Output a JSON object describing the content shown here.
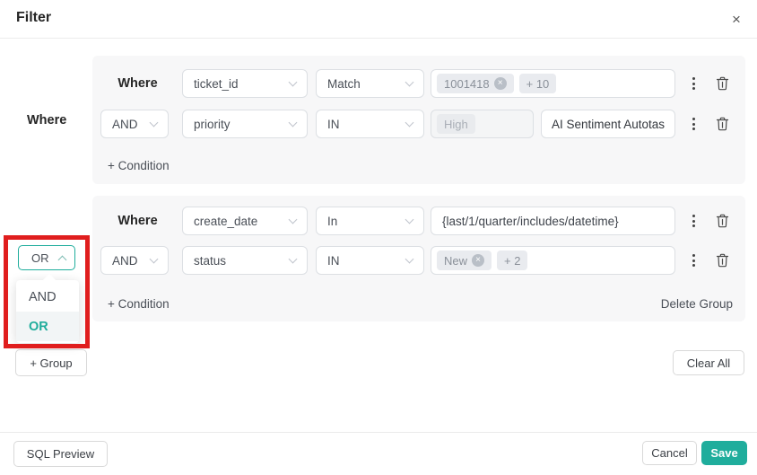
{
  "colors": {
    "accent": "#1fad9c",
    "annotation_red": "#e01e1e"
  },
  "header": {
    "title": "Filter",
    "close_glyph": "×"
  },
  "sidebar": {
    "where_label": "Where"
  },
  "icons": {
    "remove_glyph": "×"
  },
  "conjunction": {
    "selected": "OR",
    "options": [
      "AND",
      "OR"
    ]
  },
  "groups": [
    {
      "rows": [
        {
          "prefix": "Where",
          "field": "ticket_id",
          "operator": "Match",
          "tags": [
            {
              "label": "1001418",
              "removable": true
            },
            {
              "label": "+ 10",
              "removable": false
            }
          ]
        },
        {
          "prefix": "AND",
          "field": "priority",
          "operator": "IN",
          "tags": [
            {
              "label": "High",
              "removable": false
            }
          ],
          "value_disabled": true,
          "action_button": "AI Sentiment Autotas"
        }
      ],
      "add_condition_label": "+ Condition"
    },
    {
      "rows": [
        {
          "prefix": "Where",
          "field": "create_date",
          "operator": "In",
          "value_text": "{last/1/quarter/includes/datetime}"
        },
        {
          "prefix": "AND",
          "field": "status",
          "operator": "IN",
          "tags": [
            {
              "label": "New",
              "removable": true
            },
            {
              "label": "+ 2",
              "removable": false
            }
          ]
        }
      ],
      "add_condition_label": "+ Condition",
      "delete_group_label": "Delete Group"
    }
  ],
  "actions": {
    "add_group": "+ Group",
    "clear_all": "Clear All"
  },
  "footer": {
    "sql_preview": "SQL Preview",
    "cancel": "Cancel",
    "save": "Save"
  }
}
